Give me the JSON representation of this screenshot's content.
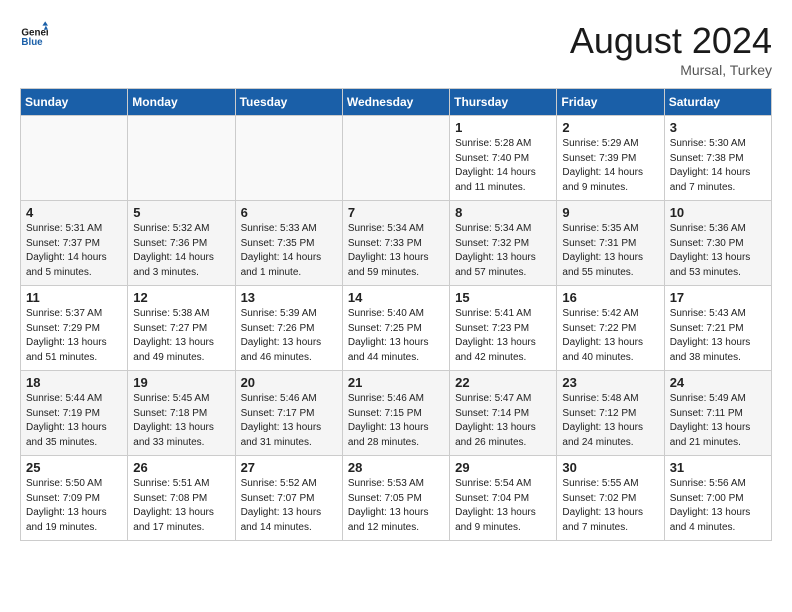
{
  "header": {
    "logo_general": "General",
    "logo_blue": "Blue",
    "month_year": "August 2024",
    "location": "Mursal, Turkey"
  },
  "days_of_week": [
    "Sunday",
    "Monday",
    "Tuesday",
    "Wednesday",
    "Thursday",
    "Friday",
    "Saturday"
  ],
  "weeks": [
    [
      {
        "day": "",
        "info": ""
      },
      {
        "day": "",
        "info": ""
      },
      {
        "day": "",
        "info": ""
      },
      {
        "day": "",
        "info": ""
      },
      {
        "day": "1",
        "info": "Sunrise: 5:28 AM\nSunset: 7:40 PM\nDaylight: 14 hours\nand 11 minutes."
      },
      {
        "day": "2",
        "info": "Sunrise: 5:29 AM\nSunset: 7:39 PM\nDaylight: 14 hours\nand 9 minutes."
      },
      {
        "day": "3",
        "info": "Sunrise: 5:30 AM\nSunset: 7:38 PM\nDaylight: 14 hours\nand 7 minutes."
      }
    ],
    [
      {
        "day": "4",
        "info": "Sunrise: 5:31 AM\nSunset: 7:37 PM\nDaylight: 14 hours\nand 5 minutes."
      },
      {
        "day": "5",
        "info": "Sunrise: 5:32 AM\nSunset: 7:36 PM\nDaylight: 14 hours\nand 3 minutes."
      },
      {
        "day": "6",
        "info": "Sunrise: 5:33 AM\nSunset: 7:35 PM\nDaylight: 14 hours\nand 1 minute."
      },
      {
        "day": "7",
        "info": "Sunrise: 5:34 AM\nSunset: 7:33 PM\nDaylight: 13 hours\nand 59 minutes."
      },
      {
        "day": "8",
        "info": "Sunrise: 5:34 AM\nSunset: 7:32 PM\nDaylight: 13 hours\nand 57 minutes."
      },
      {
        "day": "9",
        "info": "Sunrise: 5:35 AM\nSunset: 7:31 PM\nDaylight: 13 hours\nand 55 minutes."
      },
      {
        "day": "10",
        "info": "Sunrise: 5:36 AM\nSunset: 7:30 PM\nDaylight: 13 hours\nand 53 minutes."
      }
    ],
    [
      {
        "day": "11",
        "info": "Sunrise: 5:37 AM\nSunset: 7:29 PM\nDaylight: 13 hours\nand 51 minutes."
      },
      {
        "day": "12",
        "info": "Sunrise: 5:38 AM\nSunset: 7:27 PM\nDaylight: 13 hours\nand 49 minutes."
      },
      {
        "day": "13",
        "info": "Sunrise: 5:39 AM\nSunset: 7:26 PM\nDaylight: 13 hours\nand 46 minutes."
      },
      {
        "day": "14",
        "info": "Sunrise: 5:40 AM\nSunset: 7:25 PM\nDaylight: 13 hours\nand 44 minutes."
      },
      {
        "day": "15",
        "info": "Sunrise: 5:41 AM\nSunset: 7:23 PM\nDaylight: 13 hours\nand 42 minutes."
      },
      {
        "day": "16",
        "info": "Sunrise: 5:42 AM\nSunset: 7:22 PM\nDaylight: 13 hours\nand 40 minutes."
      },
      {
        "day": "17",
        "info": "Sunrise: 5:43 AM\nSunset: 7:21 PM\nDaylight: 13 hours\nand 38 minutes."
      }
    ],
    [
      {
        "day": "18",
        "info": "Sunrise: 5:44 AM\nSunset: 7:19 PM\nDaylight: 13 hours\nand 35 minutes."
      },
      {
        "day": "19",
        "info": "Sunrise: 5:45 AM\nSunset: 7:18 PM\nDaylight: 13 hours\nand 33 minutes."
      },
      {
        "day": "20",
        "info": "Sunrise: 5:46 AM\nSunset: 7:17 PM\nDaylight: 13 hours\nand 31 minutes."
      },
      {
        "day": "21",
        "info": "Sunrise: 5:46 AM\nSunset: 7:15 PM\nDaylight: 13 hours\nand 28 minutes."
      },
      {
        "day": "22",
        "info": "Sunrise: 5:47 AM\nSunset: 7:14 PM\nDaylight: 13 hours\nand 26 minutes."
      },
      {
        "day": "23",
        "info": "Sunrise: 5:48 AM\nSunset: 7:12 PM\nDaylight: 13 hours\nand 24 minutes."
      },
      {
        "day": "24",
        "info": "Sunrise: 5:49 AM\nSunset: 7:11 PM\nDaylight: 13 hours\nand 21 minutes."
      }
    ],
    [
      {
        "day": "25",
        "info": "Sunrise: 5:50 AM\nSunset: 7:09 PM\nDaylight: 13 hours\nand 19 minutes."
      },
      {
        "day": "26",
        "info": "Sunrise: 5:51 AM\nSunset: 7:08 PM\nDaylight: 13 hours\nand 17 minutes."
      },
      {
        "day": "27",
        "info": "Sunrise: 5:52 AM\nSunset: 7:07 PM\nDaylight: 13 hours\nand 14 minutes."
      },
      {
        "day": "28",
        "info": "Sunrise: 5:53 AM\nSunset: 7:05 PM\nDaylight: 13 hours\nand 12 minutes."
      },
      {
        "day": "29",
        "info": "Sunrise: 5:54 AM\nSunset: 7:04 PM\nDaylight: 13 hours\nand 9 minutes."
      },
      {
        "day": "30",
        "info": "Sunrise: 5:55 AM\nSunset: 7:02 PM\nDaylight: 13 hours\nand 7 minutes."
      },
      {
        "day": "31",
        "info": "Sunrise: 5:56 AM\nSunset: 7:00 PM\nDaylight: 13 hours\nand 4 minutes."
      }
    ]
  ]
}
